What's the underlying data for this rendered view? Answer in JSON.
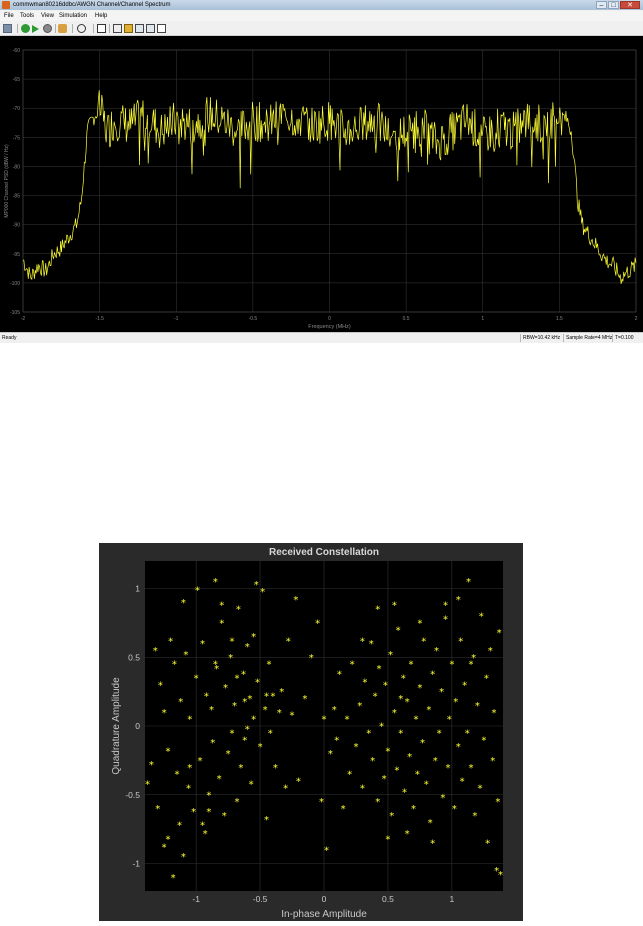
{
  "window": {
    "title": "commwman80216ddbc/AWGN Channel/Channel Spectrum",
    "buttons": {
      "minimize": "–",
      "maximize": "□",
      "close": "✕"
    }
  },
  "menu": {
    "items": [
      "File",
      "Tools",
      "View",
      "Simulation",
      "Help"
    ]
  },
  "toolbar": {
    "icons": [
      "print-icon",
      "run-icon",
      "step-icon",
      "stop-icon",
      "highlight-icon",
      "zoom-icon",
      "autoscale-icon",
      "measure-icon",
      "trigger-icon",
      "cursor-icon",
      "peak-icon",
      "stats-icon"
    ]
  },
  "status": {
    "ready": "Ready",
    "rbw": "RBW=10.42 kHz",
    "sample_rate": "Sample Rate=4 MHz",
    "time": "T=0.100"
  },
  "colors": {
    "trace": "#ffff33",
    "plot_bg": "#000000",
    "grid": "#3a3a3a",
    "fig_bg": "#2a2a2a"
  },
  "chart_data": [
    {
      "type": "line",
      "title": "",
      "xlabel": "Frequency (MHz)",
      "ylabel": "MP000 Channel PSD (dBW / Hz)",
      "xlim": [
        -2,
        2
      ],
      "ylim": [
        -105,
        -60
      ],
      "xticks": [
        -2,
        -1.5,
        -1,
        -0.5,
        0,
        0.5,
        1,
        1.5,
        2
      ],
      "xtick_labels": [
        "-2",
        "-1.5",
        "-1",
        "-0.5",
        "0",
        "0.5",
        "1",
        "1.5",
        "2"
      ],
      "yticks": [
        -60,
        -65,
        -70,
        -75,
        -80,
        -85,
        -90,
        -95,
        -100,
        -105
      ],
      "ytick_labels": [
        "-60",
        "-65",
        "-70",
        "-75",
        "-80",
        "-85",
        "-90",
        "-95",
        "-100",
        "-105"
      ],
      "grid": true,
      "series": [
        {
          "shape": "band-limited spectrum",
          "x": [
            -2,
            -1.95,
            -1.9,
            -1.85,
            -1.8,
            -1.75,
            -1.7,
            -1.65,
            -1.62,
            -1.6,
            -1.58,
            -1.55,
            -1.5,
            -1.45,
            -1.4,
            -1.3,
            -1.2,
            -1.1,
            -1.0,
            -0.9,
            -0.8,
            -0.7,
            -0.6,
            -0.5,
            -0.4,
            -0.3,
            -0.2,
            -0.1,
            0,
            0.1,
            0.2,
            0.3,
            0.4,
            0.5,
            0.6,
            0.7,
            0.8,
            0.9,
            1.0,
            1.1,
            1.2,
            1.3,
            1.4,
            1.5,
            1.55,
            1.58,
            1.6,
            1.62,
            1.65,
            1.7,
            1.75,
            1.8,
            1.85,
            1.9,
            1.95,
            2
          ],
          "y": [
            -96,
            -99,
            -97,
            -98,
            -95,
            -94,
            -92,
            -90,
            -86,
            -80,
            -74,
            -72,
            -70,
            -74,
            -72,
            -73,
            -71,
            -74,
            -72,
            -73,
            -71,
            -72,
            -74,
            -72,
            -73,
            -71,
            -72,
            -73,
            -72,
            -74,
            -73,
            -72,
            -75,
            -74,
            -73,
            -76,
            -74,
            -72,
            -75,
            -73,
            -74,
            -72,
            -73,
            -71,
            -72,
            -74,
            -80,
            -86,
            -90,
            -92,
            -94,
            -96,
            -97,
            -99,
            -98,
            -97
          ]
        }
      ]
    },
    {
      "type": "scatter",
      "title": "Received Constellation",
      "xlabel": "In-phase Amplitude",
      "ylabel": "Quadrature Amplitude",
      "xlim": [
        -1.4,
        1.4
      ],
      "ylim": [
        -1.2,
        1.2
      ],
      "xticks": [
        -1,
        -0.5,
        0,
        0.5,
        1
      ],
      "xtick_labels": [
        "-1",
        "-0.5",
        "0",
        "0.5",
        "1"
      ],
      "yticks": [
        1,
        0.5,
        0,
        -0.5,
        -1
      ],
      "ytick_labels": [
        "1",
        "0.5",
        "0",
        "-0.5",
        "-1"
      ],
      "grid": true,
      "marker": "*",
      "points": [
        [
          -1.38,
          -0.42
        ],
        [
          -1.35,
          -0.28
        ],
        [
          -1.32,
          0.55
        ],
        [
          -1.3,
          -0.6
        ],
        [
          -1.28,
          0.3
        ],
        [
          -1.25,
          0.1
        ],
        [
          -1.22,
          -0.18
        ],
        [
          -1.2,
          0.62
        ],
        [
          -1.18,
          -1.1
        ],
        [
          -1.17,
          0.45
        ],
        [
          -1.15,
          -0.35
        ],
        [
          -1.13,
          -0.72
        ],
        [
          -1.12,
          0.18
        ],
        [
          -1.1,
          -0.95
        ],
        [
          -1.08,
          0.52
        ],
        [
          -1.06,
          -0.45
        ],
        [
          -1.05,
          0.05
        ],
        [
          -1.02,
          -0.62
        ],
        [
          -1.0,
          0.35
        ],
        [
          -0.99,
          0.99
        ],
        [
          -0.97,
          -0.25
        ],
        [
          -0.95,
          0.6
        ],
        [
          -0.93,
          -0.78
        ],
        [
          -0.92,
          0.22
        ],
        [
          -0.9,
          -0.5
        ],
        [
          -0.88,
          0.12
        ],
        [
          -0.87,
          -0.12
        ],
        [
          -0.85,
          1.05
        ],
        [
          -0.84,
          0.42
        ],
        [
          -0.82,
          -0.38
        ],
        [
          -0.8,
          0.75
        ],
        [
          -0.78,
          -0.65
        ],
        [
          -0.77,
          0.28
        ],
        [
          -0.75,
          -0.2
        ],
        [
          -0.73,
          0.5
        ],
        [
          -0.72,
          -0.05
        ],
        [
          -0.7,
          0.15
        ],
        [
          -0.68,
          -0.55
        ],
        [
          -0.67,
          0.85
        ],
        [
          -0.65,
          -0.3
        ],
        [
          -0.63,
          0.38
        ],
        [
          -0.62,
          -0.1
        ],
        [
          -0.6,
          0.58
        ],
        [
          -0.58,
          0.2
        ],
        [
          -0.57,
          -0.42
        ],
        [
          -0.55,
          0.05
        ],
        [
          -0.53,
          1.03
        ],
        [
          -0.52,
          0.32
        ],
        [
          -0.5,
          -0.15
        ],
        [
          -0.48,
          0.98
        ],
        [
          -0.46,
          0.12
        ],
        [
          -0.45,
          -0.68
        ],
        [
          -0.43,
          0.45
        ],
        [
          -0.42,
          -0.05
        ],
        [
          -0.4,
          0.22
        ],
        [
          -0.38,
          -0.3
        ],
        [
          -0.35,
          0.1
        ],
        [
          -0.33,
          0.25
        ],
        [
          -0.3,
          -0.45
        ],
        [
          -0.28,
          0.62
        ],
        [
          -0.25,
          0.08
        ],
        [
          -0.22,
          0.92
        ],
        [
          -0.2,
          -0.4
        ],
        [
          -0.15,
          0.2
        ],
        [
          -0.1,
          0.5
        ],
        [
          -0.05,
          0.75
        ],
        [
          -0.02,
          -0.55
        ],
        [
          0.0,
          0.05
        ],
        [
          0.02,
          -0.9
        ],
        [
          0.05,
          -0.2
        ],
        [
          0.08,
          0.12
        ],
        [
          0.1,
          -0.1
        ],
        [
          0.12,
          0.38
        ],
        [
          0.15,
          -0.6
        ],
        [
          0.18,
          0.05
        ],
        [
          0.2,
          -0.35
        ],
        [
          0.22,
          0.45
        ],
        [
          0.25,
          -0.15
        ],
        [
          0.28,
          0.15
        ],
        [
          0.3,
          -0.45
        ],
        [
          0.32,
          0.32
        ],
        [
          0.35,
          -0.05
        ],
        [
          0.37,
          0.6
        ],
        [
          0.38,
          -0.25
        ],
        [
          0.4,
          0.22
        ],
        [
          0.42,
          -0.55
        ],
        [
          0.43,
          0.42
        ],
        [
          0.45,
          0.0
        ],
        [
          0.47,
          -0.38
        ],
        [
          0.48,
          0.3
        ],
        [
          0.5,
          -0.18
        ],
        [
          0.52,
          0.52
        ],
        [
          0.53,
          -0.65
        ],
        [
          0.55,
          0.1
        ],
        [
          0.57,
          -0.32
        ],
        [
          0.58,
          0.7
        ],
        [
          0.6,
          -0.05
        ],
        [
          0.62,
          0.35
        ],
        [
          0.63,
          -0.48
        ],
        [
          0.65,
          0.18
        ],
        [
          0.67,
          -0.22
        ],
        [
          0.68,
          0.45
        ],
        [
          0.7,
          -0.6
        ],
        [
          0.72,
          0.05
        ],
        [
          0.73,
          -0.35
        ],
        [
          0.75,
          0.28
        ],
        [
          0.77,
          -0.12
        ],
        [
          0.78,
          0.62
        ],
        [
          0.8,
          -0.42
        ],
        [
          0.82,
          0.12
        ],
        [
          0.83,
          -0.7
        ],
        [
          0.85,
          0.38
        ],
        [
          0.87,
          -0.25
        ],
        [
          0.88,
          0.55
        ],
        [
          0.9,
          -0.05
        ],
        [
          0.92,
          0.25
        ],
        [
          0.93,
          -0.52
        ],
        [
          0.95,
          0.78
        ],
        [
          0.97,
          -0.3
        ],
        [
          0.98,
          0.05
        ],
        [
          1.0,
          0.45
        ],
        [
          1.02,
          -0.6
        ],
        [
          1.03,
          0.18
        ],
        [
          1.05,
          -0.15
        ],
        [
          1.07,
          0.62
        ],
        [
          1.08,
          -0.4
        ],
        [
          1.1,
          0.3
        ],
        [
          1.12,
          -0.05
        ],
        [
          1.13,
          1.05
        ],
        [
          1.15,
          -0.3
        ],
        [
          1.17,
          0.5
        ],
        [
          1.18,
          -0.65
        ],
        [
          1.2,
          0.15
        ],
        [
          1.22,
          -0.45
        ],
        [
          1.23,
          0.8
        ],
        [
          1.25,
          -0.1
        ],
        [
          1.27,
          0.35
        ],
        [
          1.28,
          -0.85
        ],
        [
          1.3,
          0.55
        ],
        [
          1.32,
          -0.25
        ],
        [
          1.33,
          0.1
        ],
        [
          1.35,
          -1.05
        ],
        [
          1.36,
          -0.55
        ],
        [
          1.37,
          0.68
        ],
        [
          1.38,
          -1.08
        ],
        [
          -1.25,
          -0.88
        ],
        [
          -1.22,
          -0.82
        ],
        [
          -1.1,
          0.9
        ],
        [
          -0.95,
          -0.72
        ],
        [
          -0.8,
          0.88
        ],
        [
          -0.72,
          0.62
        ],
        [
          -0.68,
          0.35
        ],
        [
          -0.62,
          0.18
        ],
        [
          -0.55,
          0.65
        ],
        [
          -0.45,
          0.22
        ],
        [
          0.3,
          0.62
        ],
        [
          0.42,
          0.85
        ],
        [
          0.55,
          0.88
        ],
        [
          0.75,
          0.75
        ],
        [
          0.95,
          0.88
        ],
        [
          1.05,
          0.92
        ],
        [
          1.15,
          0.45
        ],
        [
          0.85,
          -0.85
        ],
        [
          0.65,
          -0.78
        ],
        [
          0.5,
          -0.82
        ],
        [
          -1.05,
          -0.3
        ],
        [
          -0.9,
          -0.62
        ],
        [
          -0.85,
          0.45
        ],
        [
          -0.6,
          -0.02
        ],
        [
          0.6,
          0.2
        ]
      ]
    }
  ]
}
